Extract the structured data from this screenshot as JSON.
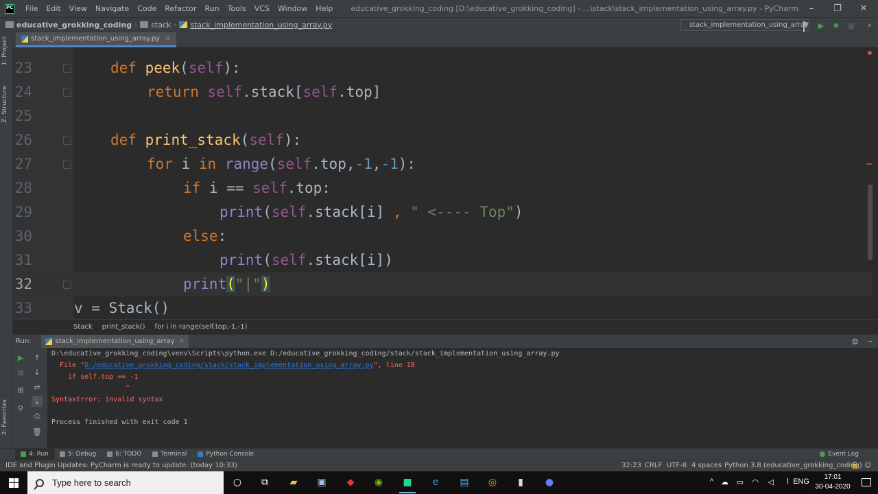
{
  "menu": [
    "File",
    "Edit",
    "View",
    "Navigate",
    "Code",
    "Refactor",
    "Run",
    "Tools",
    "VCS",
    "Window",
    "Help"
  ],
  "window_title": "educative_grokking_coding [D:\\educative_grokking_coding] - ...\\stack\\stack_implementation_using_array.py - PyCharm",
  "window_controls": {
    "minimize": "–",
    "maximize": "❐",
    "close": "✕"
  },
  "breadcrumbs": [
    "educative_grokking_coding",
    "stack",
    "stack_implementation_using_array.py"
  ],
  "run_config": "stack_implementation_using_array",
  "left_strip": {
    "project": "1: Project",
    "structure": "Z: Structure",
    "favorites": "2: Favorites"
  },
  "editor_tab": "stack_implementation_using_array.py",
  "code_lines": [
    {
      "num": "23",
      "indent": 1,
      "tokens": [
        [
          "kw",
          "def "
        ],
        [
          "fn",
          "peek"
        ],
        [
          "pl",
          "("
        ],
        [
          "self",
          "self"
        ],
        [
          "pl",
          "):"
        ]
      ]
    },
    {
      "num": "24",
      "indent": 2,
      "tokens": [
        [
          "kw",
          "return "
        ],
        [
          "self",
          "self"
        ],
        [
          "pl",
          ".stack["
        ],
        [
          "self",
          "self"
        ],
        [
          "pl",
          ".top]"
        ]
      ]
    },
    {
      "num": "25",
      "indent": 0,
      "tokens": []
    },
    {
      "num": "26",
      "indent": 1,
      "tokens": [
        [
          "kw",
          "def "
        ],
        [
          "fn",
          "print_stack"
        ],
        [
          "pl",
          "("
        ],
        [
          "self",
          "self"
        ],
        [
          "pl",
          "):"
        ]
      ]
    },
    {
      "num": "27",
      "indent": 2,
      "tokens": [
        [
          "kw",
          "for "
        ],
        [
          "pl",
          "i "
        ],
        [
          "kw",
          "in "
        ],
        [
          "bi",
          "range"
        ],
        [
          "pl",
          "("
        ],
        [
          "self",
          "self"
        ],
        [
          "pl",
          ".top,"
        ],
        [
          "num",
          "-1"
        ],
        [
          "pl",
          ","
        ],
        [
          "num",
          "-1"
        ],
        [
          "pl",
          "):"
        ]
      ]
    },
    {
      "num": "28",
      "indent": 3,
      "tokens": [
        [
          "kw",
          "if "
        ],
        [
          "pl",
          "i == "
        ],
        [
          "self",
          "self"
        ],
        [
          "pl",
          ".top:"
        ]
      ]
    },
    {
      "num": "29",
      "indent": 4,
      "tokens": [
        [
          "bi",
          "print"
        ],
        [
          "pl",
          "("
        ],
        [
          "self",
          "self"
        ],
        [
          "pl",
          ".stack[i] "
        ],
        [
          "kw",
          ", "
        ],
        [
          "str",
          "\" <---- Top\""
        ],
        [
          "pl",
          ")"
        ]
      ]
    },
    {
      "num": "30",
      "indent": 3,
      "tokens": [
        [
          "kw",
          "else"
        ],
        [
          "pl",
          ":"
        ]
      ]
    },
    {
      "num": "31",
      "indent": 4,
      "tokens": [
        [
          "bi",
          "print"
        ],
        [
          "pl",
          "("
        ],
        [
          "self",
          "self"
        ],
        [
          "pl",
          ".stack[i])"
        ]
      ]
    },
    {
      "num": "32",
      "indent": 3,
      "current": true,
      "tokens": [
        [
          "bi",
          "print"
        ],
        [
          "hl",
          "("
        ],
        [
          "str",
          "\"|\""
        ],
        [
          "hl",
          ")"
        ]
      ]
    },
    {
      "num": "33",
      "indent": 0,
      "tokens": [
        [
          "pl",
          "v = Stack()"
        ]
      ]
    }
  ],
  "code_breadcrumbs": [
    "Stack",
    "print_stack()",
    "for i in range(self.top,-1,-1)"
  ],
  "run_panel": {
    "label": "Run:",
    "tab": "stack_implementation_using_array",
    "console": {
      "command": "D:\\educative_grokking_coding\\venv\\Scripts\\python.exe D:/educative_grokking_coding/stack/stack_implementation_using_array.py",
      "file_prefix": "  File \"",
      "file_link": "D:/educative_grokking_coding/stack/stack_implementation_using_array.py",
      "file_suffix": "\", line 18",
      "code_line": "    if self.top == -1",
      "caret_line": "                  ^",
      "error": "SyntaxError: invalid syntax",
      "exit": "Process finished with exit code 1"
    }
  },
  "tool_windows": [
    "4: Run",
    "5: Debug",
    "6: TODO",
    "Terminal",
    "Python Console"
  ],
  "event_log": "Event Log",
  "status": {
    "message": "IDE and Plugin Updates: PyCharm is ready to update. (today 10:33)",
    "position": "32:23",
    "line_sep": "CRLF",
    "encoding": "UTF-8",
    "indent": "4 spaces",
    "interpreter": "Python 3.8 (educative_grokking_coding)"
  },
  "taskbar": {
    "search_placeholder": "Type here to search",
    "language": "ENG",
    "time": "17:01",
    "date": "30-04-2020"
  },
  "colors": {
    "keyword": "#cc7832",
    "function": "#ffc66d",
    "self": "#94558d",
    "number": "#6897bb",
    "string": "#6a8759",
    "error": "#ff6b68",
    "link": "#287bde"
  }
}
